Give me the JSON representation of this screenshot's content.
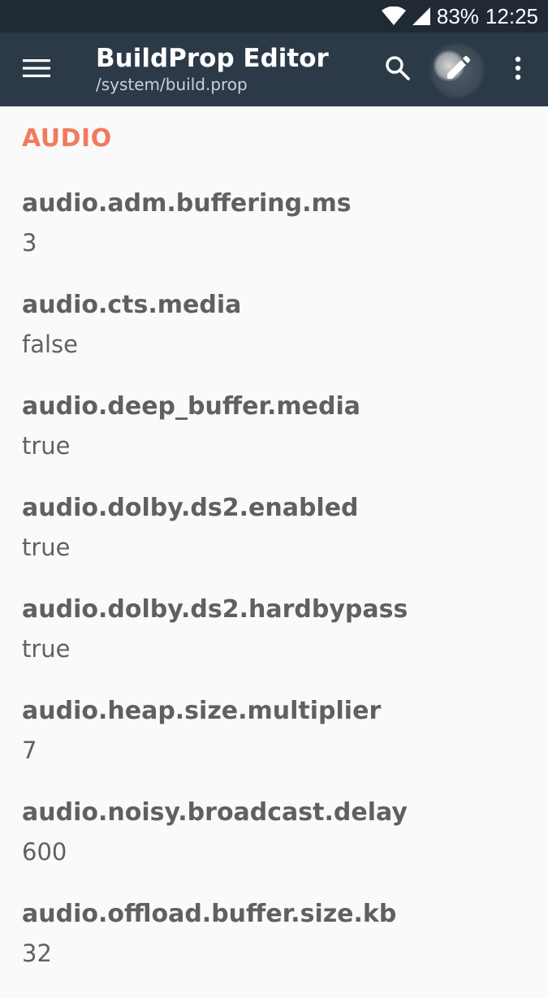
{
  "status_bar": {
    "battery": "83%",
    "time": "12:25",
    "icons": [
      "wifi-icon",
      "cell-signal-icon"
    ]
  },
  "toolbar": {
    "title": "BuildProp Editor",
    "subtitle": "/system/build.prop",
    "icons": [
      "menu-icon",
      "search-icon",
      "edit-icon",
      "more-vert-icon"
    ]
  },
  "colors": {
    "status_bar_bg": "#1f2a34",
    "toolbar_bg": "#2c3a48",
    "section_accent": "#f27a5e",
    "background": "#fafafa"
  },
  "section": {
    "title": "AUDIO"
  },
  "props": [
    {
      "key": "audio.adm.buffering.ms",
      "value": "3"
    },
    {
      "key": "audio.cts.media",
      "value": "false"
    },
    {
      "key": "audio.deep_buffer.media",
      "value": "true"
    },
    {
      "key": "audio.dolby.ds2.enabled",
      "value": "true"
    },
    {
      "key": "audio.dolby.ds2.hardbypass",
      "value": "true"
    },
    {
      "key": "audio.heap.size.multiplier",
      "value": "7"
    },
    {
      "key": "audio.noisy.broadcast.delay",
      "value": "600"
    },
    {
      "key": "audio.offload.buffer.size.kb",
      "value": "32"
    }
  ]
}
